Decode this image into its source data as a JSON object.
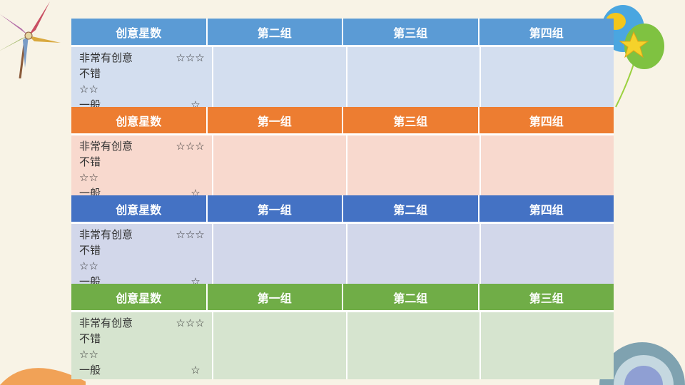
{
  "blocks": [
    {
      "header": [
        "创意星数",
        "第二组",
        "第三组",
        "第四组"
      ],
      "header_color": "#5b9bd5",
      "body_color": "#d3deef",
      "legend": {
        "line1": "非常有创意",
        "stars1": "☆☆☆",
        "line2": "不错",
        "line3": "☆☆",
        "line4": "一般",
        "stars4": "☆"
      }
    },
    {
      "header": [
        "创意星数",
        "第一组",
        "第三组",
        "第四组"
      ],
      "header_color": "#ed7d31",
      "body_color": "#f8d9ce",
      "legend": {
        "line1": "非常有创意",
        "stars1": "☆☆☆",
        "line2": "不错",
        "line3": "☆☆",
        "line4": "一般",
        "stars4": "☆"
      }
    },
    {
      "header": [
        "创意星数",
        "第一组",
        "第二组",
        "第四组"
      ],
      "header_color": "#4472c4",
      "body_color": "#d2d7ea",
      "legend": {
        "line1": "非常有创意",
        "stars1": "☆☆☆",
        "line2": "不错",
        "line3": "☆☆",
        "line4": "一般",
        "stars4": "☆"
      }
    },
    {
      "header": [
        "创意星数",
        "第一组",
        "第二组",
        "第三组"
      ],
      "header_color": "#70ad47",
      "body_color": "#d6e4cf",
      "legend": {
        "line1": "非常有创意",
        "stars1": "☆☆☆",
        "line2": "不错",
        "line3": "☆☆",
        "line4": "一般",
        "stars4": "☆"
      }
    }
  ],
  "decorations": {
    "pinwheel": "pinwheel-icon",
    "balloons": "balloons-icon",
    "rainbow": "rainbow-arc"
  }
}
